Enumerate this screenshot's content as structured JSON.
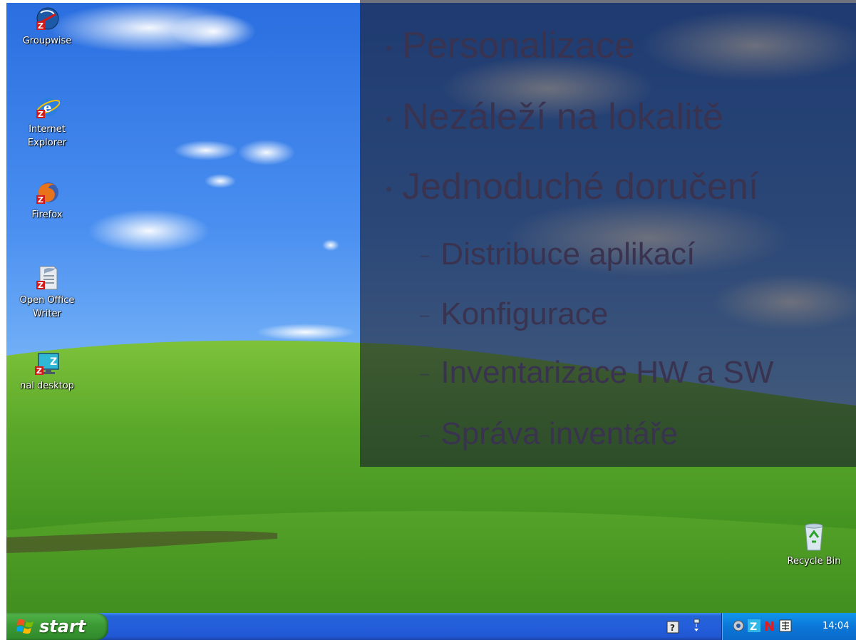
{
  "desktop": {
    "icons": [
      {
        "id": "groupwise",
        "label": "Groupwise"
      },
      {
        "id": "ie",
        "label": "Internet\nExplorer"
      },
      {
        "id": "firefox",
        "label": "Firefox"
      },
      {
        "id": "oowriter",
        "label": "Open Office\nWriter"
      },
      {
        "id": "nal",
        "label": "nal desktop"
      },
      {
        "id": "recycle",
        "label": "Recycle Bin"
      }
    ]
  },
  "slide": {
    "bullets": [
      {
        "text": "Personalizace",
        "level": 1
      },
      {
        "text": "Nezáleží na lokalitě",
        "level": 1
      },
      {
        "text": "Jednoduché doručení",
        "level": 1
      },
      {
        "text": "Distribuce aplikací",
        "level": 2
      },
      {
        "text": "Konfigurace",
        "level": 2
      },
      {
        "text": "Inventarizace HW a SW",
        "level": 2
      },
      {
        "text": "Správa inventáře",
        "level": 2
      }
    ]
  },
  "taskbar": {
    "start_label": "start",
    "clock": "14:04",
    "quicklaunch_icons": [
      "help-icon",
      "network-icon"
    ],
    "tray_icons": [
      "sound-icon",
      "zenworks-icon",
      "novell-icon",
      "language-icon"
    ]
  },
  "colors": {
    "taskbar": "#245edb",
    "start": "#3c9a35",
    "tray": "#0b77d8"
  }
}
